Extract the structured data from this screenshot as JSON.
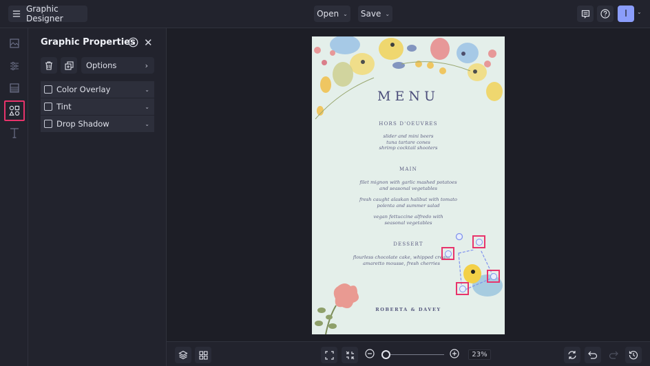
{
  "header": {
    "app_title": "Graphic Designer",
    "open_label": "Open",
    "save_label": "Save",
    "avatar_initial": "I"
  },
  "rail": {
    "items": [
      {
        "name": "images",
        "icon": "image-icon"
      },
      {
        "name": "adjustments",
        "icon": "sliders-icon"
      },
      {
        "name": "layout",
        "icon": "layout-icon"
      },
      {
        "name": "graphics",
        "icon": "shapes-icon",
        "active": true
      },
      {
        "name": "text",
        "icon": "text-icon"
      }
    ]
  },
  "panel": {
    "title": "Graphic Properties",
    "options_label": "Options",
    "properties": [
      {
        "label": "Color Overlay",
        "checked": false
      },
      {
        "label": "Tint",
        "checked": false
      },
      {
        "label": "Drop Shadow",
        "checked": false
      }
    ]
  },
  "menu": {
    "title": "MENU",
    "sections": [
      {
        "heading": "HORS D'OEUVRES",
        "items": [
          "slider and mini beers",
          "tuna tartare cones",
          "shrimp cocktail shooters"
        ]
      },
      {
        "heading": "MAIN",
        "items": [
          "filet mignon with garlic mashed potatoes",
          "and seasonal vegetables",
          "fresh caught alaskan halibut with tomato",
          "polenta and summer salad",
          "vegan fettuccine alfredo with",
          "seasonal vegetables"
        ]
      },
      {
        "heading": "DESSERT",
        "items": [
          "flourless chocolate cake, whipped cream",
          "amaretto mousse, fresh cherries"
        ]
      }
    ],
    "signature": "ROBERTA & DAVEY"
  },
  "footer": {
    "zoom_level": "23%",
    "zoom_percent": 23
  },
  "colors": {
    "accent_selection": "#e8336b",
    "avatar": "#8b9dfb",
    "menu_text": "#4b4d7a",
    "page_bg": "#e4efea"
  }
}
